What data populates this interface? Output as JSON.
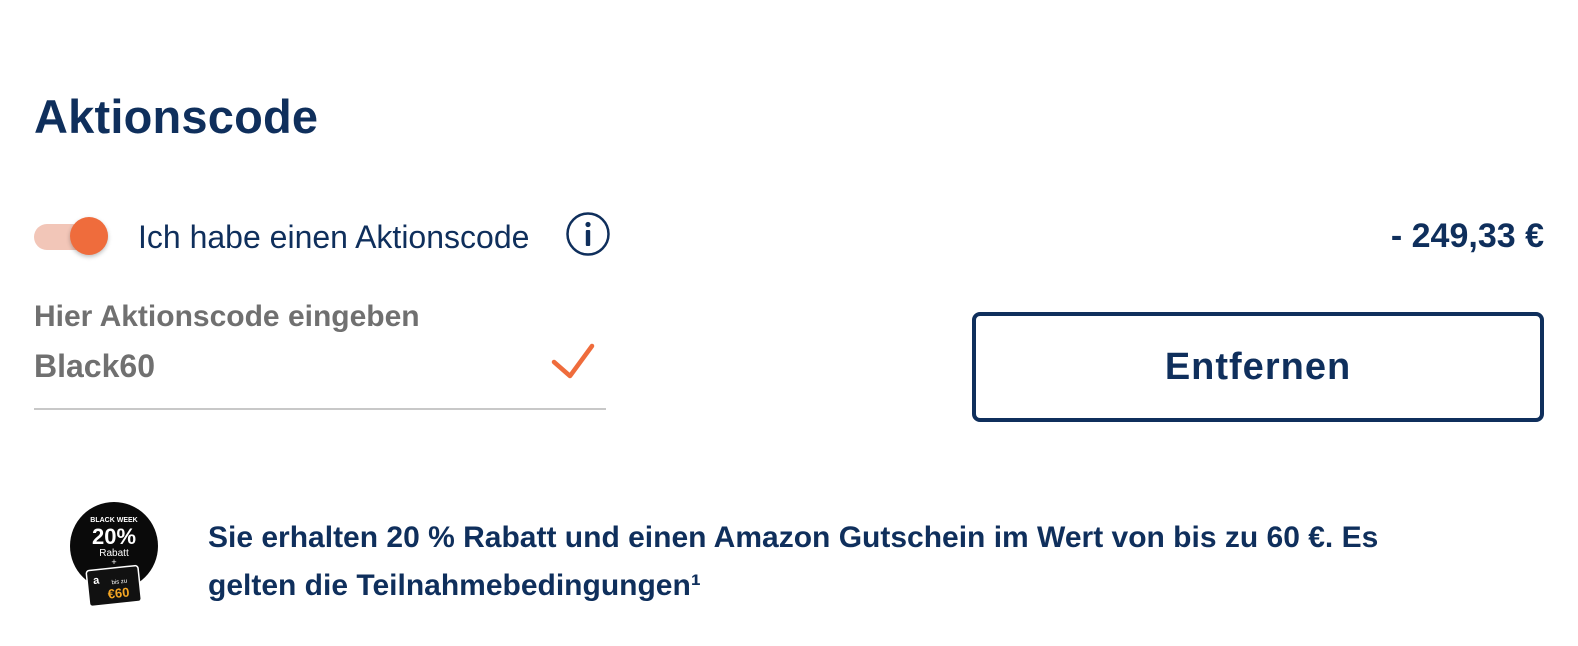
{
  "page": {
    "title": "Aktionscode"
  },
  "promo_code_toggle": {
    "label": "Ich habe einen Aktionscode",
    "checked": true,
    "info_icon": "info-icon"
  },
  "discount": {
    "amount": "- 249,33 €"
  },
  "code_field": {
    "label": "Hier Aktionscode eingeben",
    "value": "Black60",
    "status_icon": "check-icon"
  },
  "remove_button": {
    "label": "Entfernen"
  },
  "promo": {
    "badge": {
      "top_text": "BLACK WEEK",
      "percent": "20%",
      "rabatt": "Rabatt",
      "plus": "+",
      "card_letter": "a",
      "card_upto": "bis zu",
      "card_amount": "€60"
    },
    "text": "Sie erhalten 20 % Rabatt und einen Amazon Gutschein im Wert von bis zu 60 €. Es gelten die Teilnahmebedingungen¹"
  },
  "colors": {
    "navy": "#0f2f5c",
    "accent_orange": "#ef6c3c",
    "toggle_track": "#f2c6b8",
    "muted_text": "#707070"
  }
}
